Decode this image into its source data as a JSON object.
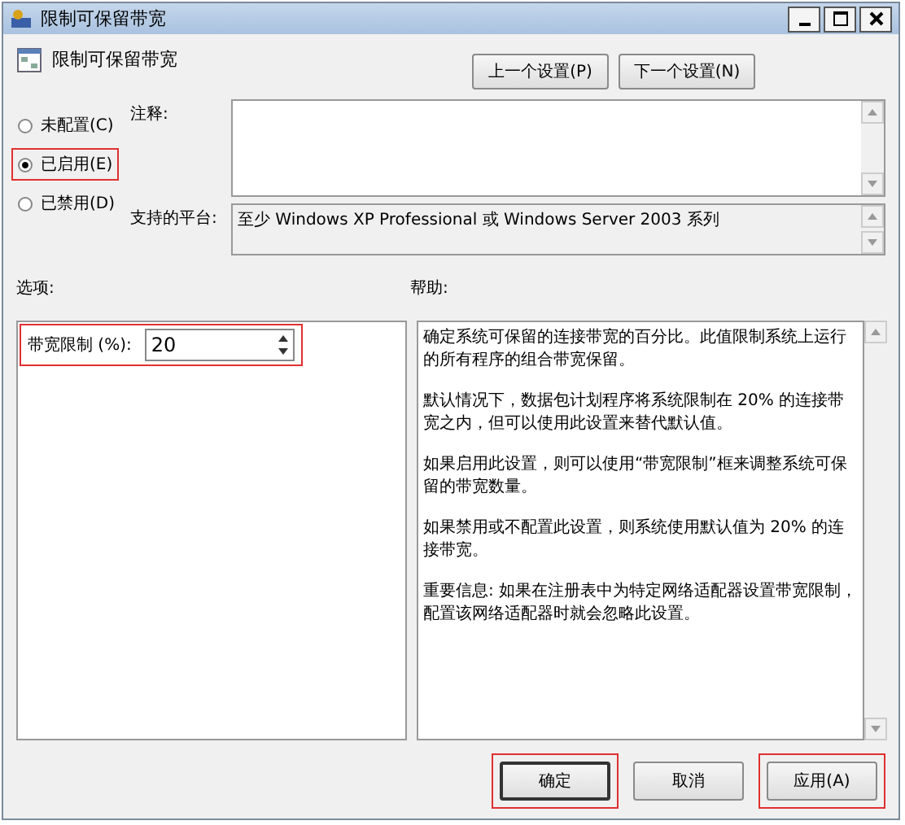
{
  "window": {
    "title": "限制可保留带宽"
  },
  "header": {
    "title": "限制可保留带宽"
  },
  "nav_buttons": [
    "上一个设置(P)",
    "下一个设置(N)"
  ],
  "radios": [
    {
      "label": "未配置(C)",
      "selected": false,
      "highlighted": false
    },
    {
      "label": "已启用(E)",
      "selected": true,
      "highlighted": true
    },
    {
      "label": "已禁用(D)",
      "selected": false,
      "highlighted": false
    }
  ],
  "comment": {
    "label": "注释:"
  },
  "platform": {
    "label": "支持的平台:",
    "value": "至少 Windows XP Professional 或 Windows Server 2003 系列"
  },
  "options": {
    "label": "选项:",
    "field": {
      "label": "带宽限制 (%):",
      "value": "20",
      "highlighted": true
    }
  },
  "help": {
    "label": "帮助:",
    "paragraphs": [
      "确定系统可保留的连接带宽的百分比。此值限制系统上运行的所有程序的组合带宽保留。",
      "默认情况下，数据包计划程序将系统限制在 20% 的连接带宽之内，但可以使用此设置来替代默认值。",
      "如果启用此设置，则可以使用“带宽限制”框来调整系统可保留的带宽数量。",
      "如果禁用或不配置此设置，则系统使用默认值为 20% 的连接带宽。",
      "重要信息: 如果在注册表中为特定网络适配器设置带宽限制，配置该网络适配器时就会忽略此设置。"
    ]
  },
  "buttons": [
    {
      "label": "确定",
      "highlighted": true,
      "default": true
    },
    {
      "label": "取消",
      "highlighted": false,
      "default": false
    },
    {
      "label": "应用(A)",
      "highlighted": true,
      "default": false
    }
  ]
}
